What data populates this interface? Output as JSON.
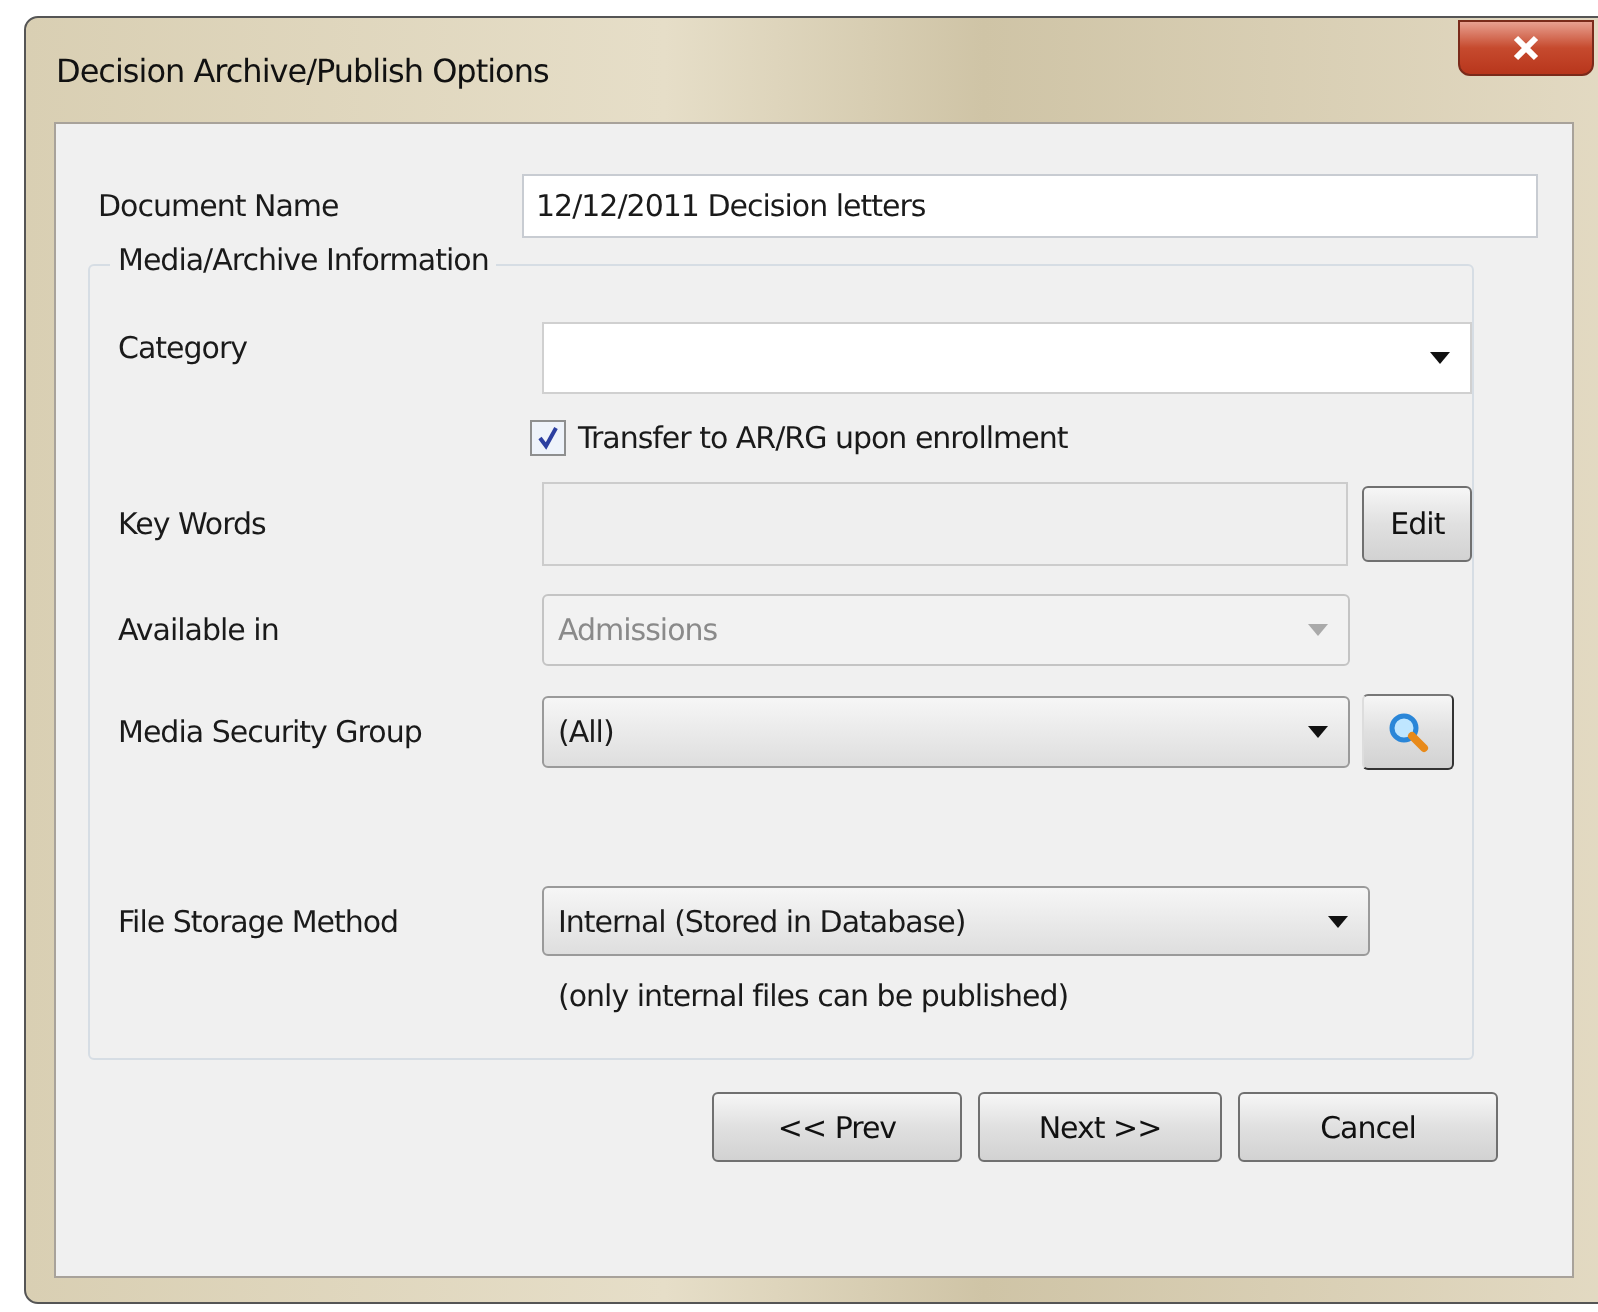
{
  "window": {
    "title": "Decision Archive/Publish Options"
  },
  "document_name": {
    "label": "Document Name",
    "value": "12/12/2011 Decision letters"
  },
  "group": {
    "title": "Media/Archive Information",
    "category": {
      "label": "Category",
      "disabled": false
    },
    "transfer": {
      "label": "Transfer to AR/RG upon enrollment",
      "checked": true
    },
    "key_words": {
      "label": "Key Words",
      "disabled": true,
      "button": "Edit"
    },
    "available_in": {
      "label": "Available in",
      "value": "Admissions",
      "disabled": true
    },
    "media_security_group": {
      "label": "Media Security Group",
      "value": "(All)",
      "disabled": false
    },
    "file_storage_method": {
      "label": "File Storage Method",
      "value": "Internal (Stored in Database)",
      "disabled": false,
      "note": "(only internal files can be published)"
    }
  },
  "buttons": [
    "<< Prev",
    "Next >>",
    "Cancel"
  ]
}
